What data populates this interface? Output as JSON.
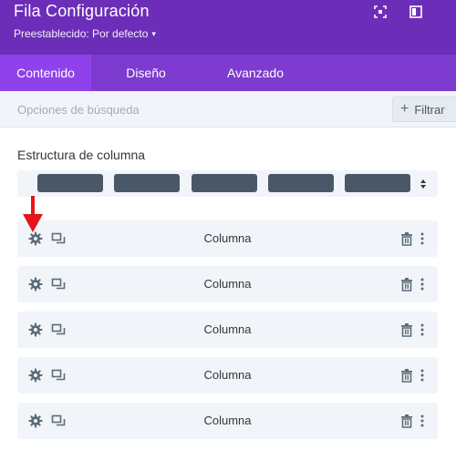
{
  "header": {
    "title": "Fila Configuración",
    "preset_label": "Preestablecido: Por defecto",
    "bg_color": "#6c2eb9"
  },
  "tabs": [
    {
      "label": "Contenido",
      "active": true
    },
    {
      "label": "Diseño",
      "active": false
    },
    {
      "label": "Avanzado",
      "active": false
    }
  ],
  "search": {
    "placeholder": "Opciones de búsqueda",
    "filter_label": "Filtrar"
  },
  "structure": {
    "label": "Estructura de columna",
    "block_count": 5
  },
  "columns": [
    {
      "label": "Columna"
    },
    {
      "label": "Columna"
    },
    {
      "label": "Columna"
    },
    {
      "label": "Columna"
    },
    {
      "label": "Columna"
    }
  ],
  "icons": {
    "header": [
      "expand-icon",
      "split-view-icon"
    ],
    "column_row": [
      "gear-icon",
      "duplicate-icon",
      "trash-icon",
      "more-vertical-icon"
    ]
  },
  "colors": {
    "tab_bar": "#7d3bcf",
    "active_tab": "#8f42ec",
    "annotation_arrow": "#e8141b"
  }
}
